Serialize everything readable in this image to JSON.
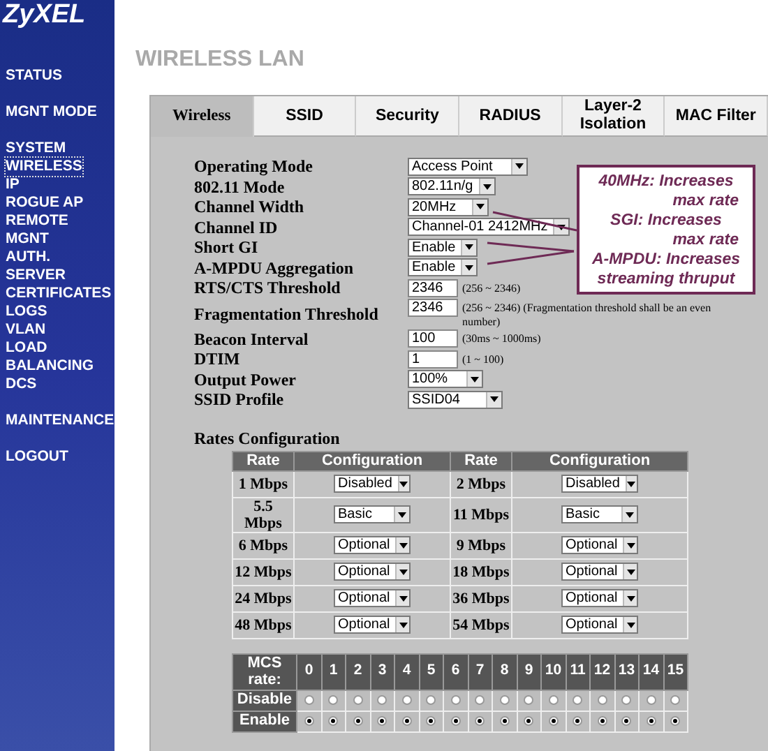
{
  "logo": "ZyXEL",
  "nav": [
    [
      {
        "label": "STATUS",
        "selected": false
      }
    ],
    [
      {
        "label": "MGNT MODE",
        "selected": false
      }
    ],
    [
      {
        "label": "SYSTEM",
        "selected": false
      },
      {
        "label": "WIRELESS",
        "selected": true
      },
      {
        "label": "IP",
        "selected": false
      },
      {
        "label": "ROGUE AP",
        "selected": false
      },
      {
        "label": "REMOTE MGNT",
        "selected": false
      },
      {
        "label": "AUTH. SERVER",
        "selected": false
      },
      {
        "label": "CERTIFICATES",
        "selected": false
      },
      {
        "label": "LOGS",
        "selected": false
      },
      {
        "label": "VLAN",
        "selected": false
      },
      {
        "label": "LOAD BALANCING",
        "selected": false
      },
      {
        "label": "DCS",
        "selected": false
      }
    ],
    [
      {
        "label": "MAINTENANCE",
        "selected": false
      }
    ],
    [
      {
        "label": "LOGOUT",
        "selected": false
      }
    ]
  ],
  "page_title": "WIRELESS LAN",
  "tabs": [
    {
      "label": "Wireless",
      "selected": true
    },
    {
      "label": "SSID",
      "selected": false
    },
    {
      "label": "Security",
      "selected": false
    },
    {
      "label": "RADIUS",
      "selected": false
    },
    {
      "label": "Layer-2 Isolation",
      "selected": false
    },
    {
      "label": "MAC Filter",
      "selected": false
    }
  ],
  "fields": [
    {
      "label": "Operating Mode",
      "kind": "select",
      "value": "Access Point"
    },
    {
      "label": "802.11 Mode",
      "kind": "select",
      "value": "802.11n/g"
    },
    {
      "label": "Channel Width",
      "kind": "select",
      "value": "20MHz"
    },
    {
      "label": "Channel ID",
      "kind": "select",
      "value": "Channel-01 2412MHz"
    },
    {
      "label": "Short GI",
      "kind": "select",
      "value": "Enable"
    },
    {
      "label": "A-MPDU Aggregation",
      "kind": "select",
      "value": "Enable"
    },
    {
      "label": "RTS/CTS Threshold",
      "kind": "input",
      "value": "2346",
      "hint": "(256 ~ 2346)"
    },
    {
      "label": "Fragmentation Threshold",
      "kind": "input",
      "value": "2346",
      "hint": "(256 ~ 2346) (Fragmentation threshold shall be an even number)"
    },
    {
      "label": "Beacon Interval",
      "kind": "input",
      "value": "100",
      "hint": "(30ms ~ 1000ms)"
    },
    {
      "label": "DTIM",
      "kind": "input",
      "value": "1",
      "hint": "(1 ~ 100)"
    },
    {
      "label": "Output Power",
      "kind": "select",
      "value": "100%"
    },
    {
      "label": "SSID Profile",
      "kind": "select",
      "value": "SSID04"
    }
  ],
  "callout": [
    {
      "text": "40MHz: Increases",
      "indented": false
    },
    {
      "text": "max rate",
      "indented": true
    },
    {
      "text": "SGI: Increases",
      "indented": false
    },
    {
      "text": "max rate",
      "indented": true
    },
    {
      "text": "A-MPDU: Increases",
      "indented": false
    },
    {
      "text": "streaming thruput",
      "indented": false
    }
  ],
  "rates": {
    "title": "Rates Configuration",
    "columns": [
      "Rate",
      "Configuration",
      "Rate",
      "Configuration"
    ],
    "rows": [
      [
        {
          "rate": "1 Mbps",
          "config": "Disabled"
        },
        {
          "rate": "2 Mbps",
          "config": "Disabled"
        }
      ],
      [
        {
          "rate": "5.5 Mbps",
          "config": "Basic"
        },
        {
          "rate": "11 Mbps",
          "config": "Basic"
        }
      ],
      [
        {
          "rate": "6 Mbps",
          "config": "Optional"
        },
        {
          "rate": "9 Mbps",
          "config": "Optional"
        }
      ],
      [
        {
          "rate": "12 Mbps",
          "config": "Optional"
        },
        {
          "rate": "18 Mbps",
          "config": "Optional"
        }
      ],
      [
        {
          "rate": "24 Mbps",
          "config": "Optional"
        },
        {
          "rate": "36 Mbps",
          "config": "Optional"
        }
      ],
      [
        {
          "rate": "48 Mbps",
          "config": "Optional"
        },
        {
          "rate": "54 Mbps",
          "config": "Optional"
        }
      ]
    ]
  },
  "mcs": {
    "header": "MCS rate:",
    "disable_label": "Disable",
    "enable_label": "Enable",
    "columns": [
      {
        "rate": "0",
        "disable_selected": false,
        "enable_selected": true
      },
      {
        "rate": "1",
        "disable_selected": false,
        "enable_selected": true
      },
      {
        "rate": "2",
        "disable_selected": false,
        "enable_selected": true
      },
      {
        "rate": "3",
        "disable_selected": false,
        "enable_selected": true
      },
      {
        "rate": "4",
        "disable_selected": false,
        "enable_selected": true
      },
      {
        "rate": "5",
        "disable_selected": false,
        "enable_selected": true
      },
      {
        "rate": "6",
        "disable_selected": false,
        "enable_selected": true
      },
      {
        "rate": "7",
        "disable_selected": false,
        "enable_selected": true
      },
      {
        "rate": "8",
        "disable_selected": false,
        "enable_selected": true
      },
      {
        "rate": "9",
        "disable_selected": false,
        "enable_selected": true
      },
      {
        "rate": "10",
        "disable_selected": false,
        "enable_selected": true
      },
      {
        "rate": "11",
        "disable_selected": false,
        "enable_selected": true
      },
      {
        "rate": "12",
        "disable_selected": false,
        "enable_selected": true
      },
      {
        "rate": "13",
        "disable_selected": false,
        "enable_selected": true
      },
      {
        "rate": "14",
        "disable_selected": false,
        "enable_selected": true
      },
      {
        "rate": "15",
        "disable_selected": false,
        "enable_selected": true
      }
    ]
  }
}
